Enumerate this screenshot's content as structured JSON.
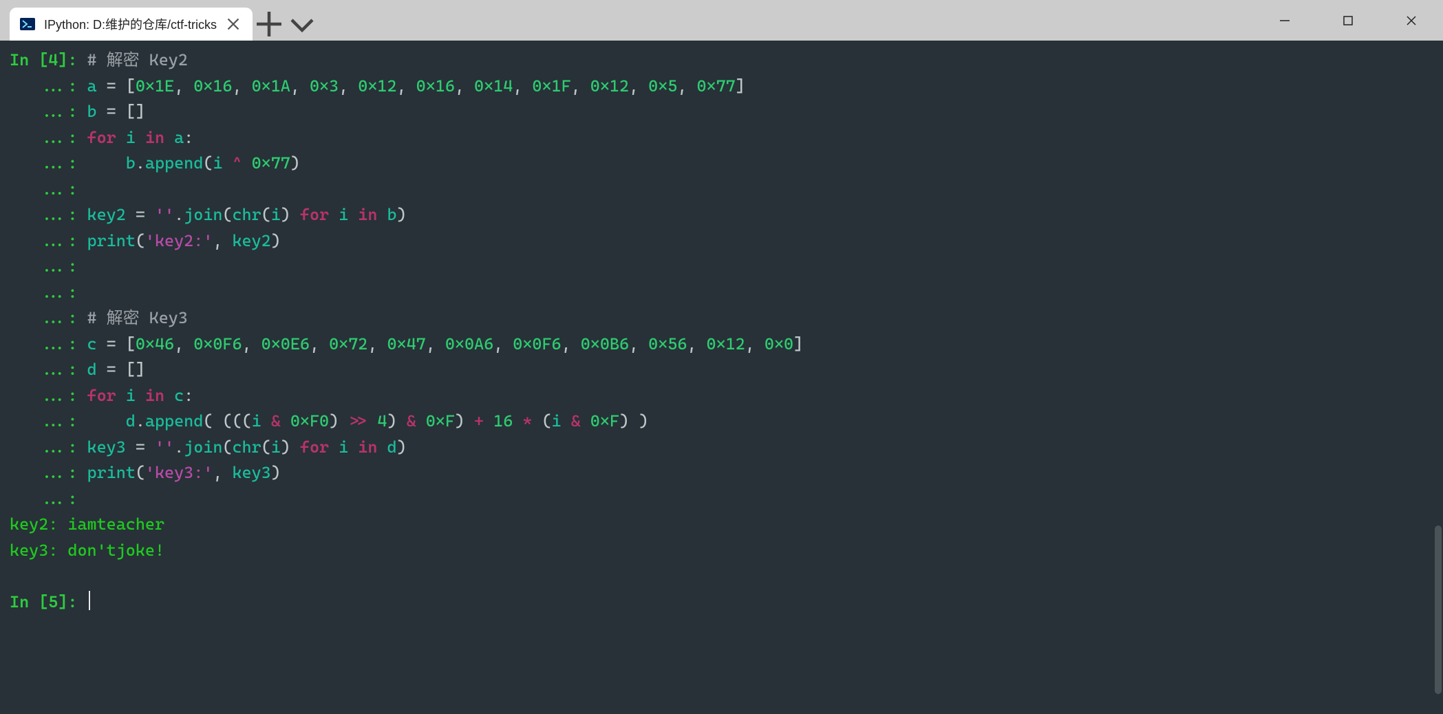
{
  "window": {
    "tab_title": "IPython: D:维护的仓库/ctf-tricks"
  },
  "session": {
    "in_label_4": "In [4]: ",
    "in_label_5": "In [5]: ",
    "cont": "   ...: ",
    "comment_key2": "# 解密 Key2",
    "comment_key3": "# 解密 Key3",
    "a_values_raw": [
      "0×1E",
      "0×16",
      "0×1A",
      "0×3",
      "0×12",
      "0×16",
      "0×14",
      "0×1F",
      "0×12",
      "0×5",
      "0×77"
    ],
    "c_values_raw": [
      "0×46",
      "0×0F6",
      "0×0E6",
      "0×72",
      "0×47",
      "0×0A6",
      "0×0F6",
      "0×0B6",
      "0×56",
      "0×12",
      "0×0"
    ],
    "xor_const": "0×77",
    "mask_F0": "0×F0",
    "mask_F": "0×F",
    "shift_4": "4",
    "mul_16": "16",
    "str_key2_label": "'key2:'",
    "str_key3_label": "'key3:'",
    "str_empty": "''",
    "out_key2": "key2: iamteacher",
    "out_key3": "key3: don'tjoke!"
  }
}
